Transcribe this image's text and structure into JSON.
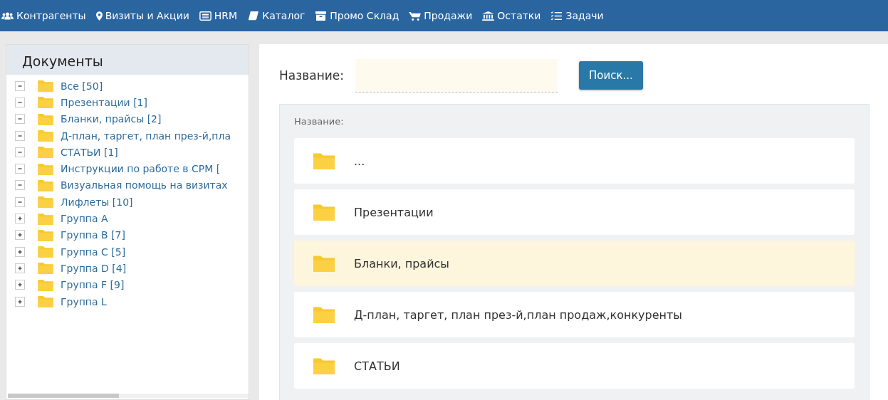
{
  "nav": [
    {
      "kind": "users",
      "label": "Контрагенты"
    },
    {
      "kind": "marker",
      "label": "Визиты и Акции"
    },
    {
      "kind": "card",
      "label": "HRM"
    },
    {
      "kind": "book",
      "label": "Каталог"
    },
    {
      "kind": "archive",
      "label": "Промо Склад"
    },
    {
      "kind": "cart",
      "label": "Продажи"
    },
    {
      "kind": "bank",
      "label": "Остатки"
    },
    {
      "kind": "tasks",
      "label": "Задачи"
    }
  ],
  "sidebar": {
    "title": "Документы",
    "items": [
      {
        "label": "Все [50]",
        "expanded": true
      },
      {
        "label": "Презентации [1]",
        "expanded": true
      },
      {
        "label": "Бланки, прайсы [2]",
        "expanded": true
      },
      {
        "label": "Д-план, таргет, план през-й,пла",
        "expanded": true
      },
      {
        "label": "СТАТЬИ [1]",
        "expanded": true
      },
      {
        "label": "Инструкции по работе в СРМ [",
        "expanded": true
      },
      {
        "label": "Визуальная помощь на визитах",
        "expanded": true
      },
      {
        "label": "Лифлеты [10]",
        "expanded": true
      },
      {
        "label": "Группа A",
        "expanded": false
      },
      {
        "label": "Группа B [7]",
        "expanded": false
      },
      {
        "label": "Группа C [5]",
        "expanded": false
      },
      {
        "label": "Группа D [4]",
        "expanded": false
      },
      {
        "label": "Группа F [9]",
        "expanded": false
      },
      {
        "label": "Группа L",
        "expanded": false
      }
    ]
  },
  "search": {
    "label": "Название:",
    "button": "Поиск..."
  },
  "list": {
    "header": "Название:",
    "rows": [
      {
        "label": "...",
        "selected": false
      },
      {
        "label": "Презентации",
        "selected": false
      },
      {
        "label": "Бланки, прайсы",
        "selected": true
      },
      {
        "label": "Д-план, таргет, план през-й,план продаж,конкуренты",
        "selected": false
      },
      {
        "label": "СТАТЬИ",
        "selected": false
      }
    ]
  }
}
